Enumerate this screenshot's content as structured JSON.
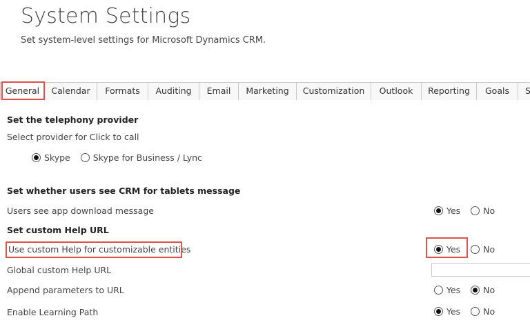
{
  "page": {
    "title": "System Settings",
    "subtitle": "Set system-level settings for Microsoft Dynamics CRM."
  },
  "tabs": [
    {
      "label": "General",
      "active": true
    },
    {
      "label": "Calendar"
    },
    {
      "label": "Formats"
    },
    {
      "label": "Auditing"
    },
    {
      "label": "Email"
    },
    {
      "label": "Marketing"
    },
    {
      "label": "Customization"
    },
    {
      "label": "Outlook"
    },
    {
      "label": "Reporting"
    },
    {
      "label": "Goals"
    },
    {
      "label": "S"
    }
  ],
  "telephony": {
    "heading": "Set the telephony provider",
    "label": "Select provider for Click to call",
    "options": [
      "Skype",
      "Skype for Business / Lync"
    ],
    "selected": "Skype"
  },
  "tablets": {
    "heading": "Set whether users see CRM for tablets message",
    "app_download": {
      "label": "Users see app download message",
      "yes": "Yes",
      "no": "No",
      "selected": "Yes"
    }
  },
  "help": {
    "heading": "Set custom Help URL",
    "custom_help": {
      "label": "Use custom Help for customizable entities",
      "yes": "Yes",
      "no": "No",
      "selected": "Yes"
    },
    "global_url": {
      "label": "Global custom Help URL",
      "value": ""
    },
    "append_params": {
      "label": "Append parameters to URL",
      "yes": "Yes",
      "no": "No",
      "selected": "No"
    },
    "learning_path": {
      "label": "Enable Learning Path",
      "yes": "Yes",
      "no": "No",
      "selected": "Yes"
    }
  },
  "colors": {
    "highlight": "#d9534f",
    "tab_border": "#c8c8c8"
  }
}
